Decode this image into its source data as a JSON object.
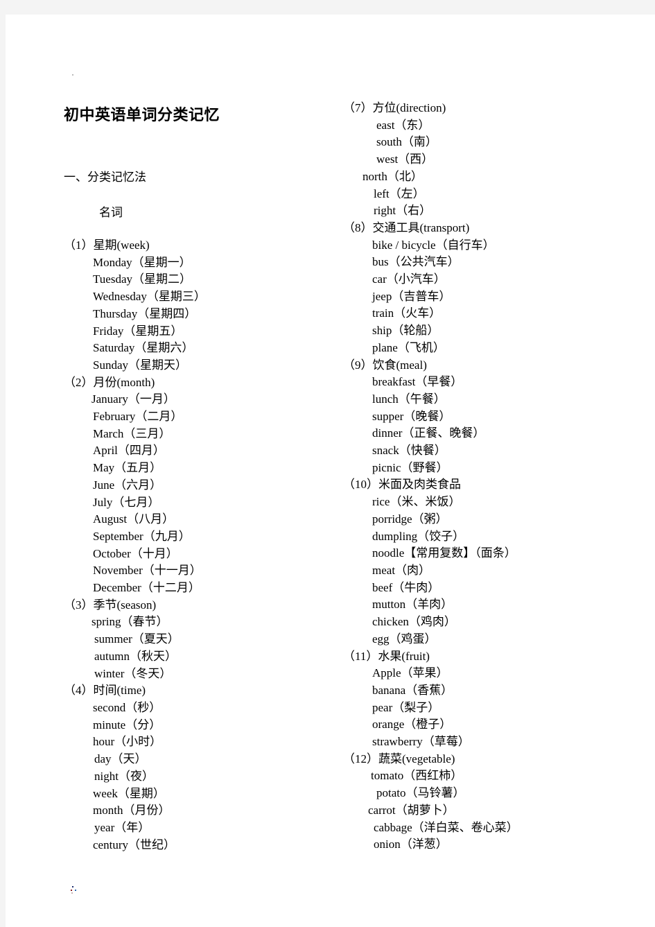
{
  "document": {
    "title": "初中英语单词分类记忆",
    "section_heading": "一、分类记忆法",
    "subsection_heading": "名词"
  },
  "left_column": [
    {
      "group_title": "（1）星期(week)",
      "items": [
        "Monday（星期一）",
        "Tuesday（星期二）",
        "Wednesday（星期三）",
        "Thursday（星期四）",
        "Friday（星期五）",
        "Saturday（星期六）",
        "Sunday（星期天）"
      ]
    },
    {
      "group_title": "（2）月份(month)",
      "items": [
        "January（一月）",
        "February（二月）",
        "March（三月）",
        "April（四月）",
        "May（五月）",
        "June（六月）",
        "July（七月）",
        "August（八月）",
        "September（九月）",
        "October（十月）",
        "November（十一月）",
        "December（十二月）"
      ]
    },
    {
      "group_title": "（3）季节(season)",
      "items": [
        "spring（春节）",
        "summer（夏天）",
        "autumn（秋天）",
        "winter（冬天）"
      ]
    },
    {
      "group_title": "（4）时间(time)",
      "items": [
        "second（秒）",
        "minute（分）",
        "hour（小时）",
        "day（天）",
        "night（夜）",
        "week（星期）",
        "month（月份）",
        "year（年）",
        "century（世纪）"
      ]
    }
  ],
  "right_column": [
    {
      "group_title": "（7）方位(direction)",
      "items": [
        "east（东）",
        "south（南）",
        "west（西）",
        "north（北）",
        "left（左）",
        "right（右）"
      ]
    },
    {
      "group_title": "（8）交通工具(transport)",
      "items": [
        "bike / bicycle（自行车）",
        "bus（公共汽车）",
        "car（小汽车）",
        "jeep（吉普车）",
        "train（火车）",
        "ship（轮船）",
        "plane（飞机）"
      ]
    },
    {
      "group_title": "（9）饮食(meal)",
      "items": [
        "breakfast（早餐）",
        "lunch（午餐）",
        "supper（晚餐）",
        "dinner（正餐、晚餐）",
        "snack（快餐）",
        "picnic（野餐）"
      ]
    },
    {
      "group_title": "（10）米面及肉类食品",
      "items": [
        "rice（米、米饭）",
        "porridge（粥）",
        "dumpling（饺子）",
        "noodle【常用复数】（面条）",
        "meat（肉）",
        "beef（牛肉）",
        "mutton（羊肉）",
        "chicken（鸡肉）",
        "egg（鸡蛋）"
      ]
    },
    {
      "group_title": "（11）水果(fruit)",
      "items": [
        "Apple（苹果）",
        "banana（香蕉）",
        "pear（梨子）",
        "orange（橙子）",
        "strawberry（草莓）"
      ]
    },
    {
      "group_title": "（12）蔬菜(vegetable)",
      "items": [
        "tomato（西红柿）",
        "potato（马铃薯）",
        "carrot（胡萝卜）",
        "cabbage（洋白菜、卷心菜）",
        "onion（洋葱）"
      ]
    }
  ]
}
